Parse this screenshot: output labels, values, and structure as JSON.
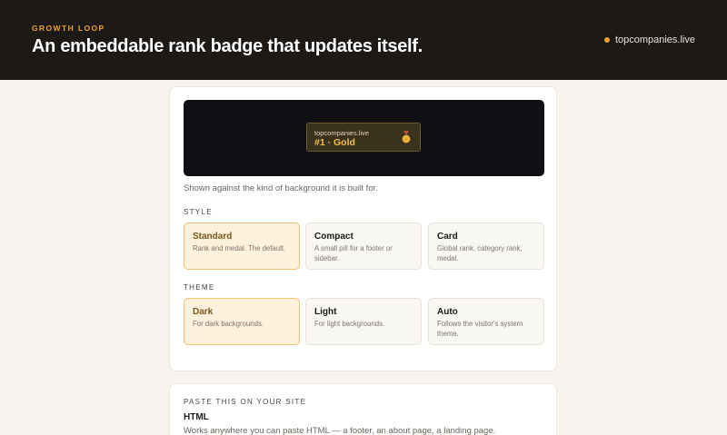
{
  "hero": {
    "eyebrow": "GROWTH LOOP",
    "title": "An embeddable rank badge that updates itself.",
    "site": "topcompanies.live"
  },
  "preview": {
    "badge_host": "topcompanies.live",
    "badge_rank": "#1 · Gold",
    "medal_icon": "gold-medal",
    "caption": "Shown against the kind of background it is built for."
  },
  "style": {
    "label": "STYLE",
    "options": [
      {
        "title": "Standard",
        "desc": "Rank and medal. The default.",
        "selected": true
      },
      {
        "title": "Compact",
        "desc": "A small pill for a footer or sidebar.",
        "selected": false
      },
      {
        "title": "Card",
        "desc": "Global rank, category rank, medal.",
        "selected": false
      }
    ]
  },
  "theme": {
    "label": "THEME",
    "options": [
      {
        "title": "Dark",
        "desc": "For dark backgrounds.",
        "selected": true
      },
      {
        "title": "Light",
        "desc": "For light backgrounds.",
        "selected": false
      },
      {
        "title": "Auto",
        "desc": "Follows the visitor's system theme.",
        "selected": false
      }
    ]
  },
  "paste": {
    "label": "PASTE THIS ON YOUR SITE",
    "heading": "HTML",
    "desc": "Works anywhere you can paste HTML — a footer, an about page, a landing page."
  },
  "colors": {
    "accent": "#f0a12e",
    "hero_bg": "#1c1916",
    "selected_bg": "#fdf1dc",
    "selected_border": "#efc173"
  }
}
